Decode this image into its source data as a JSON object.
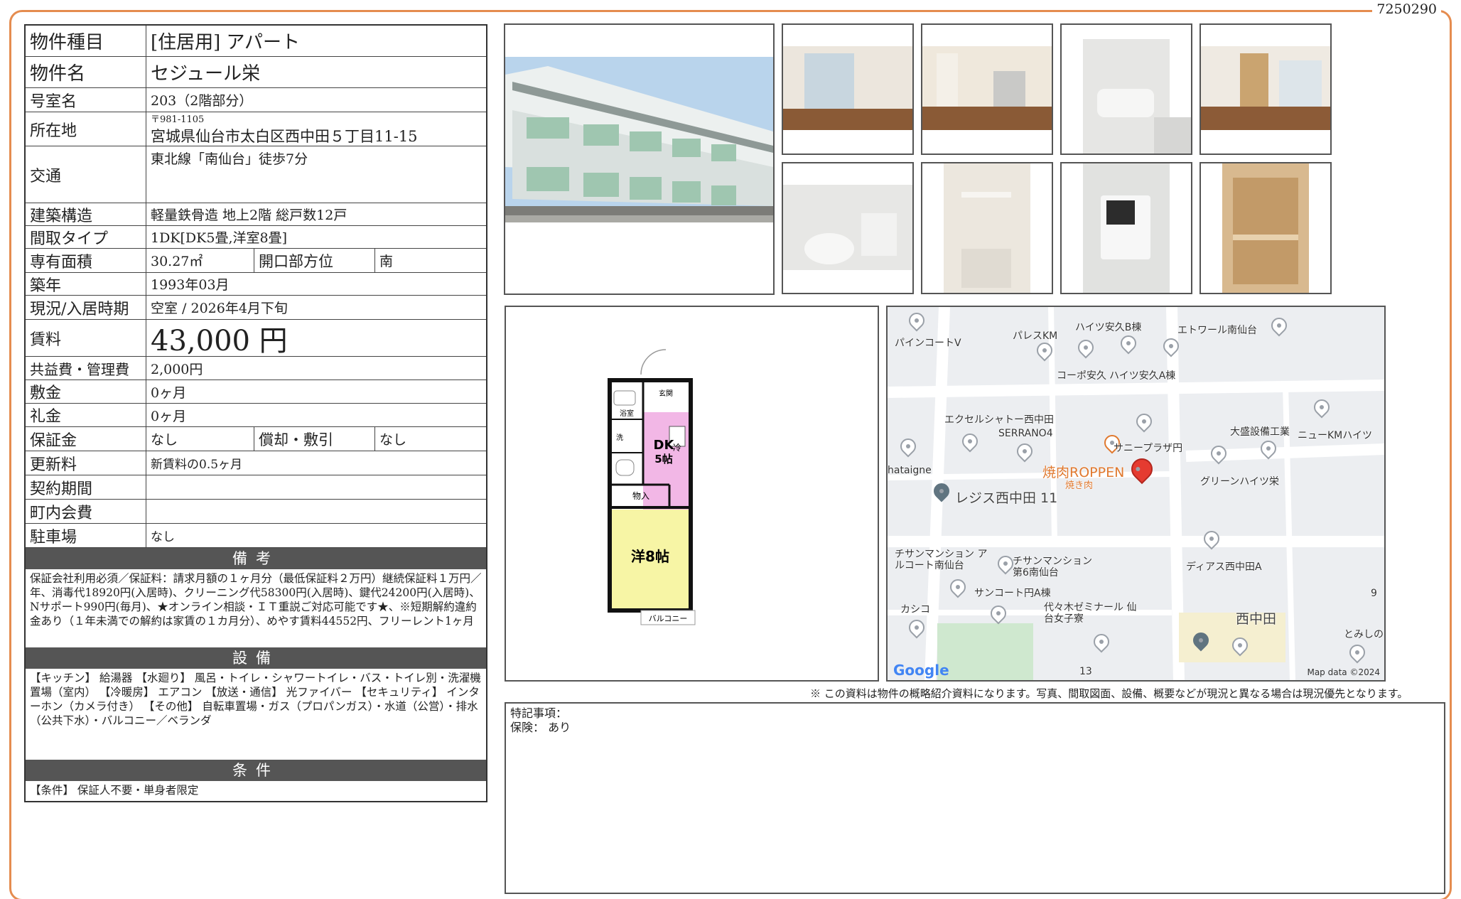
{
  "doc_id": "7250290",
  "property": {
    "type_label": "物件種目",
    "type_value": "[住居用] アパート",
    "name_label": "物件名",
    "name_value": "セジュール栄",
    "room_label": "号室名",
    "room_value": "203（2階部分）",
    "location_label": "所在地",
    "location_zip": "〒981-1105",
    "location_address": "宮城県仙台市太白区西中田５丁目11-15",
    "traffic_label": "交通",
    "traffic_value": "東北線「南仙台」徒歩7分",
    "structure_label": "建築構造",
    "structure_value": "軽量鉄骨造 地上2階 総戸数12戸",
    "layout_label": "間取タイプ",
    "layout_value": "1DK[DK5畳,洋室8畳]",
    "area_label": "専有面積",
    "area_value": "30.27㎡",
    "direction_label": "開口部方位",
    "direction_value": "南",
    "built_label": "築年",
    "built_value": "1993年03月",
    "status_label": "現況/入居時期",
    "status_value": "空室 / 2026年4月下旬",
    "rent_label": "賃料",
    "rent_value": "43,000 円",
    "fee_label": "共益費・管理費",
    "fee_value": "2,000円",
    "deposit_label": "敷金",
    "deposit_value": "0ヶ月",
    "keymoney_label": "礼金",
    "keymoney_value": "0ヶ月",
    "guarantee_label": "保証金",
    "guarantee_value": "なし",
    "amort_label": "償却・敷引",
    "amort_value": "なし",
    "renewal_label": "更新料",
    "renewal_value": "新賃料の0.5ヶ月",
    "contract_label": "契約期間",
    "contract_value": "",
    "town_label": "町内会費",
    "town_value": "",
    "parking_label": "駐車場",
    "parking_value": "なし"
  },
  "remarks": {
    "heading": "備考",
    "text": "保証会社利用必須／保証料：請求月額の１ヶ月分（最低保証料２万円）継続保証料１万円／年、消毒代18920円(入居時)、クリーニング代58300円(入居時)、鍵代24200円(入居時)、Nサポート990円(毎月)、★オンライン相談・ＩＴ重説ご対応可能です★、※短期解約違約金あり（１年未満での解約は家賃の１カ月分）、めやす賃料44552円、フリーレント1ヶ月"
  },
  "equipment": {
    "heading": "設備",
    "text": "【キッチン】 給湯器 【水廻り】 風呂・トイレ・シャワートイレ・バス・トイレ別・洗濯機置場（室内） 【冷暖房】 エアコン 【放送・通信】 光ファイバー 【セキュリティ】 インターホン（カメラ付き） 【その他】 自転車置場・ガス（プロパンガス）・水道（公営）・排水（公共下水）・バルコニー／ベランダ"
  },
  "conditions": {
    "heading": "条件",
    "text": "【条件】 保証人不要・単身者限定"
  },
  "floorplan": {
    "genkan": "玄関",
    "bath": "浴室",
    "wash": "洗",
    "dk": "DK",
    "dk_size": "5帖",
    "fridge": "冷",
    "storage": "物入",
    "western": "洋8帖",
    "balcony": "バルコニー"
  },
  "map": {
    "labels": [
      "パインコートV",
      "パレスKM",
      "ハイツ安久B棟",
      "エトワール南仙台",
      "コーポ安久",
      "ハイツ安久A棟",
      "エクセルシャトー西中田",
      "SERRANO4",
      "サニープラザ円",
      "大盛設備工業",
      "ニューKMハイツ",
      "hataigne",
      "グリーンハイツ栄",
      "チサンマンション アルコート南仙台",
      "チサンマンション 第6南仙台",
      "サンコート円A棟",
      "ディアス西中田A",
      "カシコ",
      "代々木ゼミナール 仙台女子寮",
      "とみしの",
      "9",
      "13"
    ],
    "restaurant": "焼肉ROPPEN",
    "restaurant_sub": "焼き肉",
    "residence": "レジス西中田 11",
    "area_name": "西中田",
    "google": "Google",
    "map_data": "Map data ©2024"
  },
  "disclaimer": "※ この資料は物件の概略紹介資料になります。写真、間取図面、設備、概要などが現況と異なる場合は現況優先となります。",
  "special": {
    "heading": "特記事項：",
    "insurance": "保険： あり"
  }
}
